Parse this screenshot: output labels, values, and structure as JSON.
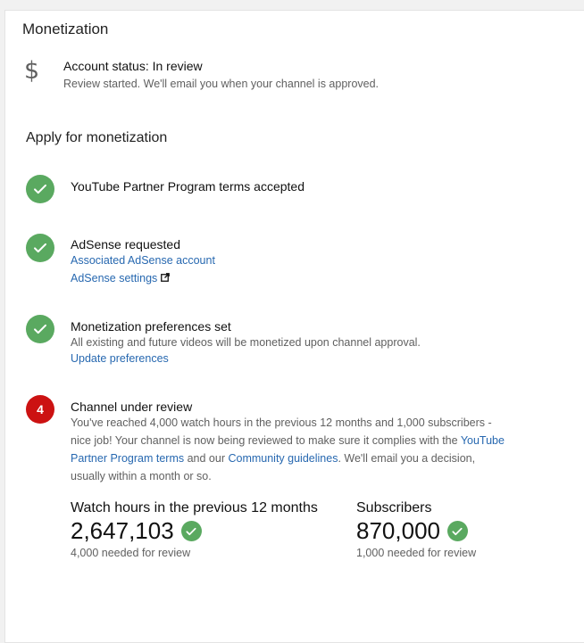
{
  "header": {
    "title": "Monetization"
  },
  "account_status": {
    "icon": "dollar-icon",
    "title": "Account status: In review",
    "subtitle": "Review started. We'll email you when your channel is approved."
  },
  "apply": {
    "title": "Apply for monetization",
    "steps": [
      {
        "state": "done",
        "title": "YouTube Partner Program terms accepted"
      },
      {
        "state": "done",
        "title": "AdSense requested",
        "links": [
          "Associated AdSense account",
          "AdSense settings"
        ]
      },
      {
        "state": "done",
        "title": "Monetization preferences set",
        "description": "All existing and future videos will be monetized upon channel approval.",
        "link": "Update preferences"
      },
      {
        "state": "current",
        "number": "4",
        "title": "Channel under review",
        "description_part1": "You've reached 4,000 watch hours in the previous 12 months and 1,000 subscribers - nice job! Your channel is now being reviewed to make sure it complies with the ",
        "link_ypp_terms": "YouTube Partner Program terms",
        "description_part2": " and our ",
        "link_guidelines": "Community guidelines",
        "description_part3": ". We'll email you a decision, usually within a month or so."
      }
    ]
  },
  "stats": {
    "watch_hours": {
      "label": "Watch hours in the previous 12 months",
      "value": "2,647,103",
      "note": "4,000 needed for review"
    },
    "subscribers": {
      "label": "Subscribers",
      "value": "870,000",
      "note": "1,000 needed for review"
    }
  },
  "colors": {
    "check_green": "#5aa960",
    "step_red": "#cc1212",
    "link_blue": "#2768b0"
  }
}
